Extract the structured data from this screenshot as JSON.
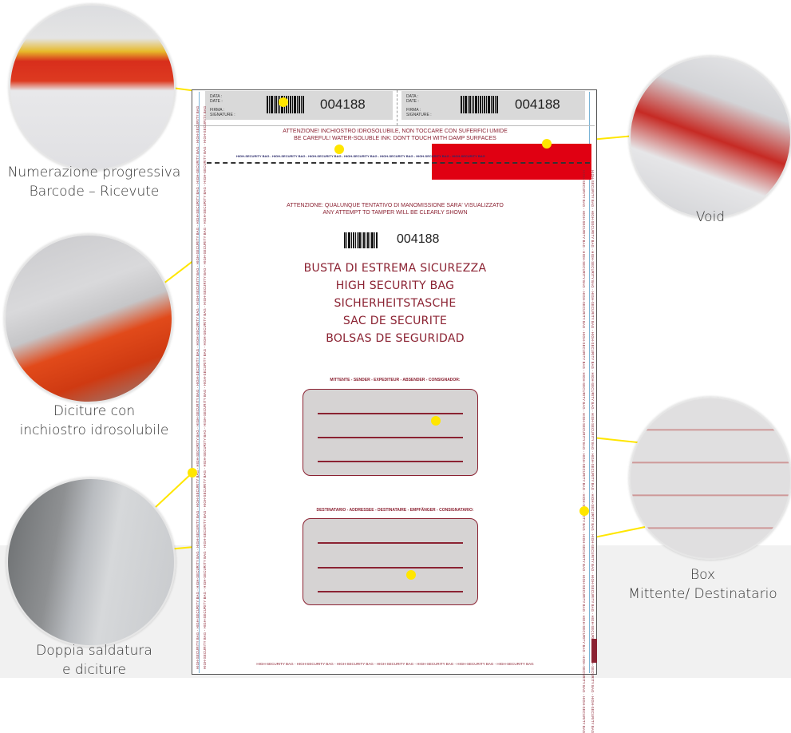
{
  "captions": {
    "numerazione_line1": "Numerazione progressiva",
    "numerazione_line2": "Barcode – Ricevute",
    "diciture_line1": "Diciture con",
    "diciture_line2": "inchiostro idrosolubile",
    "saldatura_line1": "Doppia saldatura",
    "saldatura_line2": "e diciture",
    "void": "Void",
    "box_line1": "Box",
    "box_line2": "Mittente/ Destinatario"
  },
  "bag": {
    "receipt_left": {
      "data_label": "DATA :",
      "date_label": "DATE :",
      "firma_label": "FIRMA :",
      "signature_label": "SIGNATURE :",
      "number": "004188"
    },
    "receipt_right": {
      "data_label": "DATA :",
      "date_label": "DATE :",
      "firma_label": "FIRMA :",
      "signature_label": "SIGNATURE :",
      "number": "004188"
    },
    "warning_ink_it": "ATTENZIONE! INCHIOSTRO IDROSOLUBILE, NON TOCCARE CON SUFERFICI UMIDE",
    "warning_ink_en": "BE CAREFUL! WATER-SOLUBLE INK: DON'T TOUCH WITH DAMP SURFACES",
    "security_strip": "HIGH-SECURITY BAG - HIGH-SECURITY BAG - HIGH-SECURITY BAG - HIGH-SECURITY BAG - HIGH-SECURITY BAG - HIGH-SECURITY BAG - HIGH-SECURITY BAG",
    "tamper_it": "ATTENZIONE: QUALUNQUE TENTATIVO DI MANOMISSIONE SARA' VISUALIZZATO",
    "tamper_en": "ANY ATTEMPT TO TAMPER WILL BE CLEARLY SHOWN",
    "main_number": "004188",
    "titles": [
      "BUSTA DI ESTREMA SICUREZZA",
      "HIGH SECURITY BAG",
      "SICHERHEITSTASCHE",
      "SAC DE SECURITE",
      "BOLSAS DE SEGURIDAD"
    ],
    "sender_label": "MITTENTE - SENDER - EXPEDITEUR - ABSENDER - CONSIGNADOR:",
    "recipient_label": "DESTINATARIO - ADDRESSEE - DESTINATAIRE - EMPFÄNGER - CONSIGNATARIO:",
    "side_text": "HIGH-SECURITY BAG - HIGH-SECURITY BAG - HIGH-SECURITY BAG - HIGH-SECURITY BAG - HIGH-SECURITY BAG - HIGH-SECURITY BAG - HIGH-SECURITY BAG - HIGH-SECURITY BAG - HIGH-SECURITY BAG - HIGH-SECURITY BAG - HIGH-SECURITY BAG - HIGH-SECURITY BAG - HIGH-SECURITY BAG - HIGH-SECURITY BAG",
    "footer": "HIGH-SECURITY BAG - HIGH-SECURITY BAG - HIGH-SECURITY BAG - HIGH-SECURITY BAG - HIGH-SECURITY BAG - HIGH-SECURITY BAG - HIGH-SECURITY BAG"
  },
  "colors": {
    "accent": "#ffe600",
    "text_red": "#8b2232",
    "void_red": "#e00012",
    "box_fill": "#d6d3d3",
    "bottom_band": "#f1f1f1"
  }
}
